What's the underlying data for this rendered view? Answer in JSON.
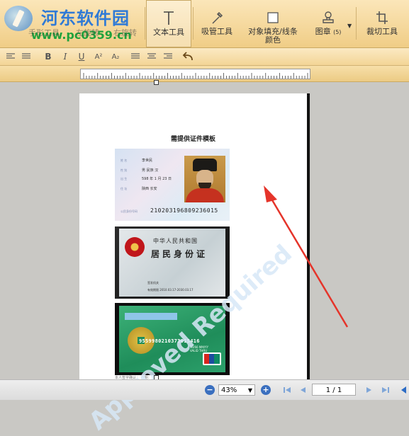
{
  "toolbar": {
    "watermark": {
      "title": "河东软件园",
      "url": "www.pc0359.cn"
    },
    "ghost_labels": [
      "手形工具",
      "左旋转",
      "右旋转"
    ],
    "tools": [
      {
        "label": "文本工具",
        "icon": "text-cursor-icon",
        "active": true
      },
      {
        "label": "吸管工具",
        "icon": "eyedropper-icon"
      },
      {
        "label_line1": "对象填充/线条",
        "label_line2": "颜色",
        "icon": "color-square-icon"
      },
      {
        "label": "图章",
        "badge": "(5)",
        "icon": "stamp-icon"
      },
      {
        "label": "裁切工具",
        "icon": "crop-icon"
      }
    ]
  },
  "format_bar": {
    "buttons": [
      "B",
      "I",
      "U",
      "A²",
      "A₂"
    ]
  },
  "document": {
    "title": "需提供证件模板",
    "card1": {
      "rows": [
        {
          "label": "姓 名",
          "value": "李世民"
        },
        {
          "label": "性 别",
          "value": "男  民族 汉"
        },
        {
          "label": "出 生",
          "value": "598 年 1 月 23 日"
        },
        {
          "label": "住 址",
          "value": "陕西 长安"
        }
      ],
      "id_label": "公民身份号码",
      "id_number": "210203196809236015"
    },
    "card2": {
      "country": "中华人民共和国",
      "title": "居民身份证",
      "issuer": "签发机关",
      "validity": "有效期限  2010.03.17-2030.03.17"
    },
    "card3": {
      "number": "9559980210373015416",
      "meta1": "10/66  MM/YY",
      "meta2": "VALID THRU"
    },
    "footer": "本人签字确认：                          日期：",
    "diagonal_watermark": "Approved Required"
  },
  "statusbar": {
    "zoom": "43%",
    "page": "1 / 1"
  }
}
